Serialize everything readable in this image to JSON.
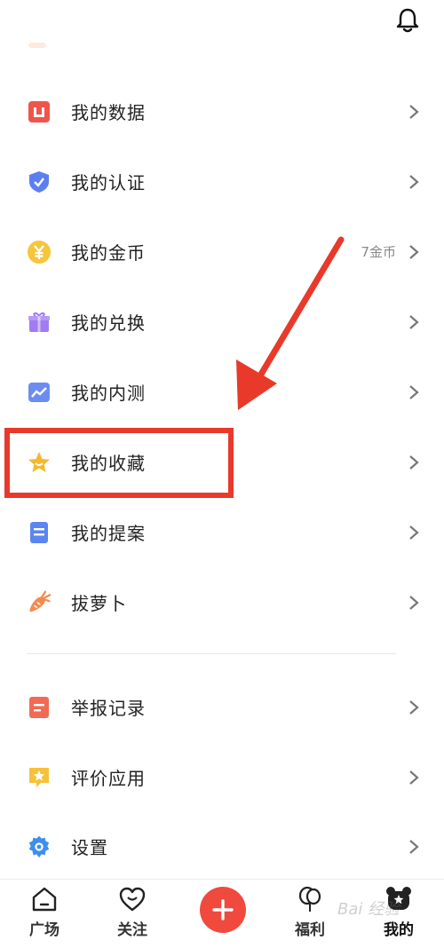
{
  "header": {
    "bell_icon": "bell-icon"
  },
  "menu_items": [
    {
      "label": "我的数据",
      "icon": "data-icon",
      "color": "#f0554a",
      "extra": ""
    },
    {
      "label": "我的认证",
      "icon": "shield-check-icon",
      "color": "#5b7ff0",
      "extra": ""
    },
    {
      "label": "我的金币",
      "icon": "coin-icon",
      "color": "#f6c53b",
      "extra": "7金币"
    },
    {
      "label": "我的兑换",
      "icon": "gift-icon",
      "color": "#a07cf0",
      "extra": ""
    },
    {
      "label": "我的内测",
      "icon": "trend-icon",
      "color": "#6d8cf2",
      "extra": ""
    },
    {
      "label": "我的收藏",
      "icon": "star-icon",
      "color": "#f5b82e",
      "extra": ""
    },
    {
      "label": "我的提案",
      "icon": "document-icon",
      "color": "#5b86f0",
      "extra": ""
    },
    {
      "label": "拔萝卜",
      "icon": "carrot-icon",
      "color": "#f58a4e",
      "extra": ""
    }
  ],
  "secondary_items": [
    {
      "label": "举报记录",
      "icon": "report-icon",
      "color": "#f26a55"
    },
    {
      "label": "评价应用",
      "icon": "rate-star-icon",
      "color": "#f5c23a"
    },
    {
      "label": "设置",
      "icon": "settings-gear-icon",
      "color": "#3d8ef0"
    }
  ],
  "tabs": [
    {
      "label": "广场",
      "icon": "home-icon"
    },
    {
      "label": "关注",
      "icon": "heart-icon"
    },
    {
      "label": "",
      "icon": "plus-icon"
    },
    {
      "label": "福利",
      "icon": "balloon-icon"
    },
    {
      "label": "我的",
      "icon": "bear-icon"
    }
  ],
  "colors": {
    "accent_red": "#f04a3e",
    "annotation_red": "#e8392a"
  },
  "watermark": "Bai 经验"
}
